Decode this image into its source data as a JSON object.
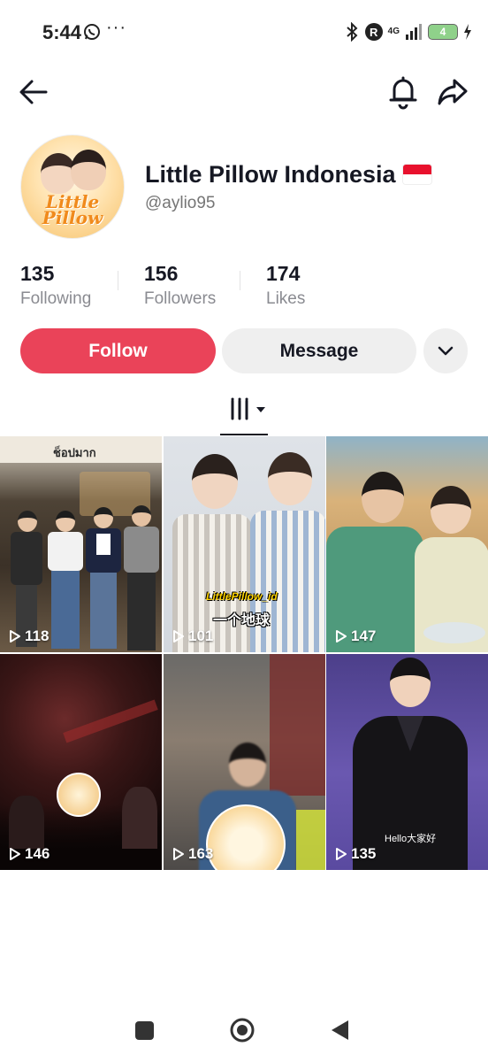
{
  "status_bar": {
    "time": "5:44",
    "menu_dots": "···",
    "r_badge": "R",
    "network": "4G",
    "battery": "4"
  },
  "profile": {
    "display_name": "Little Pillow Indonesia",
    "flag": "🇮🇩",
    "username": "@aylio95",
    "avatar_text": "Little Pillow"
  },
  "stats": [
    {
      "value": "135",
      "label": "Following"
    },
    {
      "value": "156",
      "label": "Followers"
    },
    {
      "value": "174",
      "label": "Likes"
    }
  ],
  "actions": {
    "follow": "Follow",
    "message": "Message"
  },
  "videos": [
    {
      "views": "118",
      "caption": "ช็อปมาก"
    },
    {
      "views": "101",
      "caption": "LittlePillow_id",
      "caption2": "一个地球"
    },
    {
      "views": "147"
    },
    {
      "views": "146"
    },
    {
      "views": "163"
    },
    {
      "views": "135",
      "caption": "Hello大家好"
    }
  ],
  "colors": {
    "follow_bg": "#ea4359",
    "secondary_bg": "#efefef",
    "text_primary": "#161823",
    "text_secondary": "#8a8b91"
  }
}
